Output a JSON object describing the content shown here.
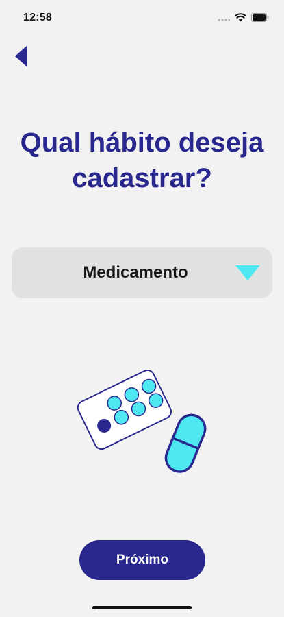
{
  "status_bar": {
    "time": "12:58",
    "icons": [
      "signal-dots-icon",
      "wifi-icon",
      "battery-icon"
    ]
  },
  "nav": {
    "back_icon": "back-arrow-icon"
  },
  "main": {
    "title": "Qual hábito deseja cadastrar?",
    "select": {
      "selected_value": "Medicamento",
      "arrow_icon": "dropdown-triangle-icon"
    },
    "illustration": "medicine-pills-illustration",
    "next_label": "Próximo"
  },
  "colors": {
    "background": "#f2f2f2",
    "primary": "#28288f",
    "accent": "#4fe8f2",
    "select_background": "#e2e2e2"
  }
}
